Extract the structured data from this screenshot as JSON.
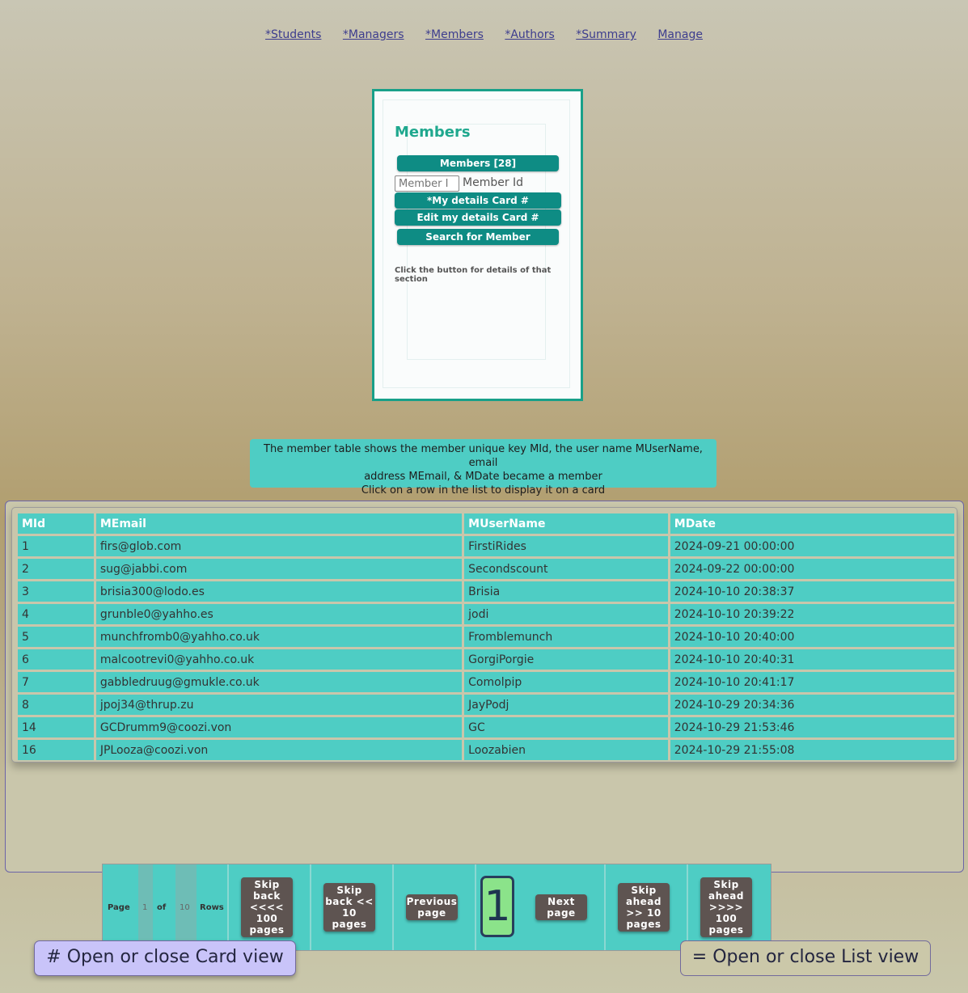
{
  "nav": {
    "students": "*Students",
    "managers": "*Managers",
    "members": "*Members",
    "authors": "*Authors",
    "summary": "*Summary",
    "manage": "Manage"
  },
  "card": {
    "title": "Members",
    "members_button": "Members [28]",
    "member_id_placeholder": "Member I",
    "member_id_label": "Member Id",
    "my_details_button": "*My details Card #",
    "edit_details_button": "Edit my details Card #",
    "search_button": "Search for Member",
    "hint": "Click the button for details of that section"
  },
  "info": {
    "line1": "The member table shows the member unique key MId, the user name MUserName, email",
    "line2": "address MEmail, & MDate became a member",
    "line3": "Click on a row in the list to display it on a card"
  },
  "table": {
    "headers": [
      "MId",
      "MEmail",
      "MUserName",
      "MDate"
    ],
    "rows": [
      [
        "1",
        "firs@glob.com",
        "FirstiRides",
        "2024-09-21 00:00:00"
      ],
      [
        "2",
        "sug@jabbi.com",
        "Secondscount",
        "2024-09-22 00:00:00"
      ],
      [
        "3",
        "brisia300@lodo.es",
        "Brisia",
        "2024-10-10 20:38:37"
      ],
      [
        "4",
        "grunble0@yahho.es",
        "jodi",
        "2024-10-10 20:39:22"
      ],
      [
        "5",
        "munchfromb0@yahho.co.uk",
        "Fromblemunch",
        "2024-10-10 20:40:00"
      ],
      [
        "6",
        "malcootrevi0@yahho.co.uk",
        "GorgiPorgie",
        "2024-10-10 20:40:31"
      ],
      [
        "7",
        "gabbledruug@gmukle.co.uk",
        "Comolpip",
        "2024-10-10 20:41:17"
      ],
      [
        "8",
        "jpoj34@thrup.zu",
        "JayPodj",
        "2024-10-29 20:34:36"
      ],
      [
        "14",
        "GCDrumm9@coozi.von",
        "GC",
        "2024-10-29 21:53:46"
      ],
      [
        "16",
        "JPLooza@coozi.von",
        "Loozabien",
        "2024-10-29 21:55:08"
      ]
    ]
  },
  "pager": {
    "page_label": "Page",
    "page_value": "1",
    "of_label": "of",
    "total_value": "10",
    "rows_label": "Rows",
    "skip_back_100": "Skip back <<<< 100 pages",
    "skip_back_10": "Skip back << 10 pages",
    "previous": "Previous page",
    "current": "1",
    "next": "Next page",
    "skip_ahead_10": "Skip ahead >> 10 pages",
    "skip_ahead_100": "Skip ahead >>>> 100 pages"
  },
  "toggles": {
    "card_view": "# Open or close Card view",
    "list_view": "= Open or close List view"
  }
}
